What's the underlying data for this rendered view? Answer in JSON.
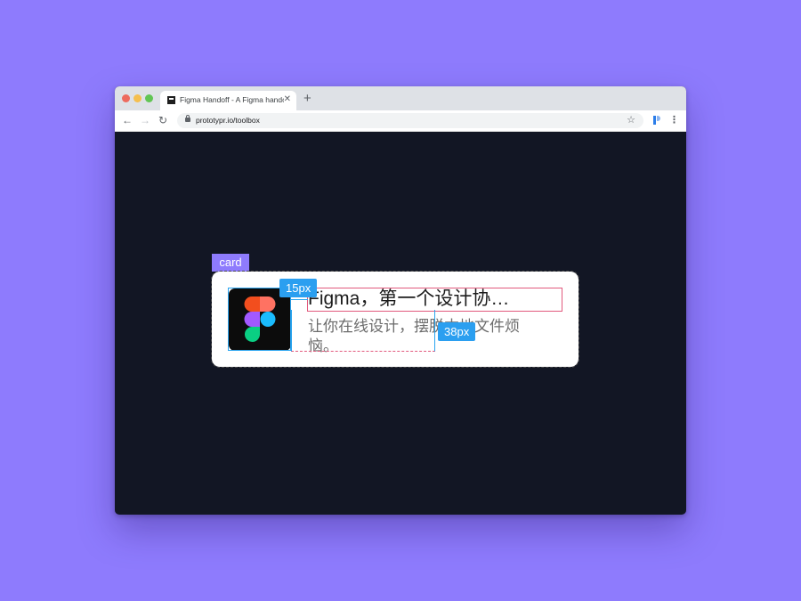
{
  "browser": {
    "tab_title": "Figma Handoff - A Figma handoff",
    "tab_close": "✕",
    "new_tab": "+",
    "url": "prototypr.io/toolbox",
    "nav": {
      "back": "←",
      "forward": "→",
      "reload": "↻"
    },
    "star": "☆",
    "menu": "⋮"
  },
  "inspector": {
    "card_label": "card",
    "spacing_left": "15px",
    "spacing_right": "38px"
  },
  "card": {
    "title": "Figma，第一个设计协…",
    "description": "让你在线设计，摆脱本地文件烦恼。"
  },
  "colors": {
    "background": "#8e7bfd",
    "content_bg": "#121624",
    "measure_blue": "#2b9ff0",
    "highlight_pink": "#e2597d",
    "figma_red": "#f24e1e",
    "figma_orange": "#ff7262",
    "figma_purple": "#a259ff",
    "figma_blue": "#1abcfe",
    "figma_green": "#0acf83"
  },
  "icons": [
    "lock-icon",
    "star-icon",
    "menu-icon",
    "figma-logo-icon",
    "extension-icon"
  ]
}
